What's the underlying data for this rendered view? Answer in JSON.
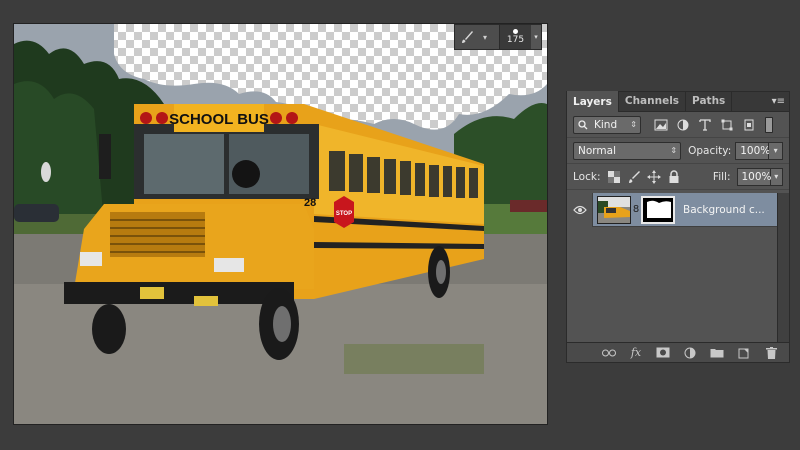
{
  "canvas": {
    "bus_sign": "SCHOOL BUS",
    "bus_number": "28",
    "stop_sign": "STOP"
  },
  "brush": {
    "size": "175"
  },
  "layers_panel": {
    "tabs": [
      "Layers",
      "Channels",
      "Paths"
    ],
    "active_tab": "Layers",
    "filter_kind": "Kind",
    "blend_mode": "Normal",
    "opacity_label": "Opacity:",
    "opacity_value": "100%",
    "lock_label": "Lock:",
    "fill_label": "Fill:",
    "fill_value": "100%",
    "layers": [
      {
        "name": "Background c...",
        "visible": true,
        "selected": true,
        "has_mask": true
      }
    ]
  },
  "colors": {
    "selection_highlight": "#7e8da0",
    "panel_bg": "#535353",
    "app_bg": "#3c3c3c"
  }
}
